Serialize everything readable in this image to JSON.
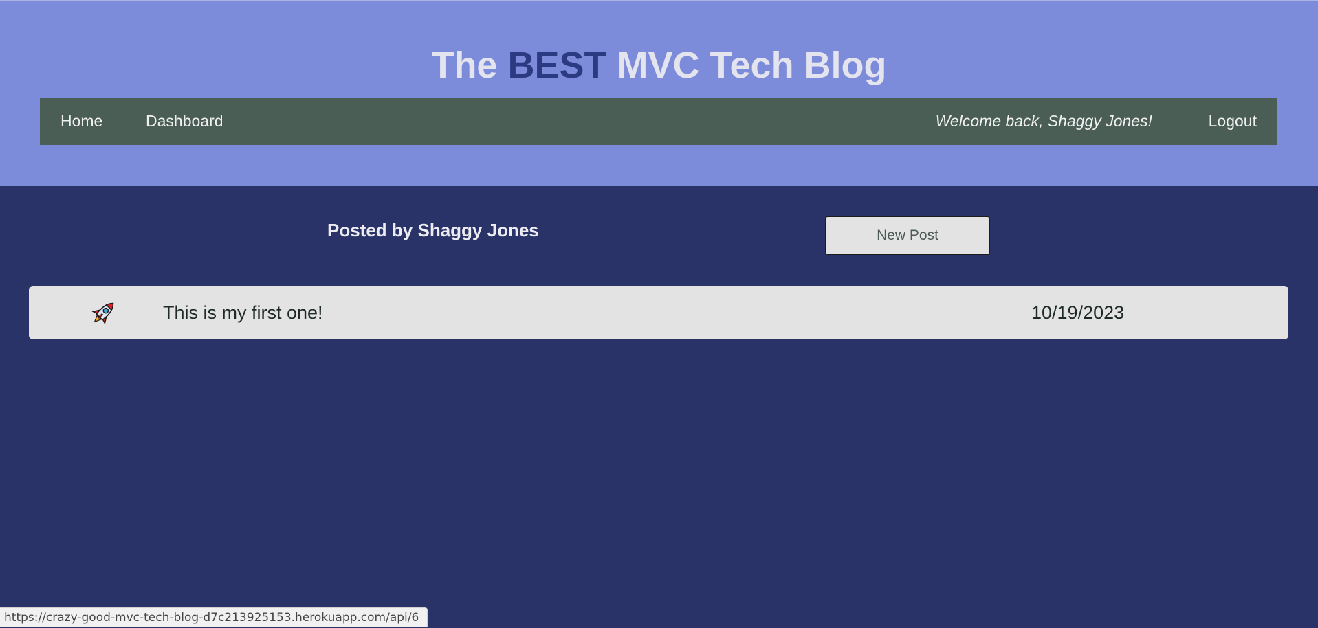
{
  "header": {
    "title_prefix": "The",
    "title_highlight": "BEST",
    "title_suffix": "MVC Tech Blog",
    "accent_color": "#2c3a82",
    "background_color": "#7d8cda"
  },
  "nav": {
    "home_label": "Home",
    "dashboard_label": "Dashboard",
    "welcome_text": "Welcome back, Shaggy Jones!",
    "logout_label": "Logout",
    "background_color": "#4a5e55"
  },
  "dashboard": {
    "posted_by": "Posted by Shaggy Jones",
    "new_post_label": "New Post",
    "background_color": "#2a3367",
    "posts": [
      {
        "icon": "rocket-icon",
        "title": "This is my first one!",
        "date": "10/19/2023"
      }
    ]
  },
  "status_bar": {
    "url": "https://crazy-good-mvc-tech-blog-d7c213925153.herokuapp.com/api/6"
  }
}
